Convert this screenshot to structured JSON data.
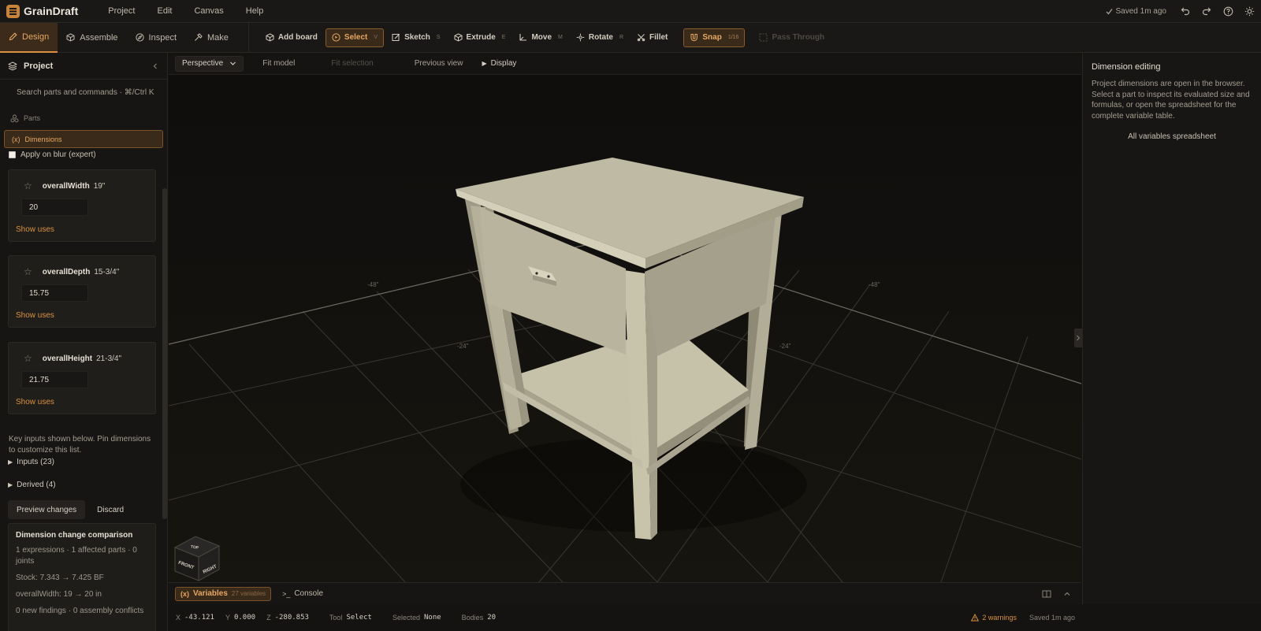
{
  "app": {
    "name": "GrainDraft",
    "menus": [
      "Project",
      "Edit",
      "Canvas",
      "Help"
    ],
    "saved_status": "Saved 1m ago"
  },
  "workspaces": [
    {
      "label": "Design",
      "icon": "pencil-icon",
      "active": true
    },
    {
      "label": "Assemble",
      "icon": "cube-icon",
      "active": false
    },
    {
      "label": "Inspect",
      "icon": "compass-icon",
      "active": false
    },
    {
      "label": "Make",
      "icon": "hammer-icon",
      "active": false
    }
  ],
  "tools": [
    {
      "label": "Add board",
      "key": "",
      "icon": "cube-plus-icon",
      "state": "normal"
    },
    {
      "label": "Select",
      "key": "V",
      "icon": "cursor-circle-icon",
      "state": "active"
    },
    {
      "label": "Sketch",
      "key": "S",
      "icon": "sketch-icon",
      "state": "normal"
    },
    {
      "label": "Extrude",
      "key": "E",
      "icon": "extrude-icon",
      "state": "normal"
    },
    {
      "label": "Move",
      "key": "M",
      "icon": "move-icon",
      "state": "normal"
    },
    {
      "label": "Rotate",
      "key": "R",
      "icon": "rotate-icon",
      "state": "normal"
    },
    {
      "label": "Fillet",
      "key": "",
      "icon": "fillet-icon",
      "state": "normal"
    }
  ],
  "snap": {
    "label": "Snap",
    "value": "1/16"
  },
  "pass_through": {
    "label": "Pass Through"
  },
  "left_panel": {
    "title": "Project",
    "search_placeholder": "Search parts and commands · ⌘/Ctrl K",
    "parts_label": "Parts",
    "dimensions_label": "Dimensions",
    "apply_on_blur": "Apply on blur (expert)",
    "dimensions": [
      {
        "name": "overallWidth",
        "display": "19\"",
        "input": "20",
        "uses": "Show uses"
      },
      {
        "name": "overallDepth",
        "display": "15-3/4\"",
        "input": "15.75",
        "uses": "Show uses"
      },
      {
        "name": "overallHeight",
        "display": "21-3/4\"",
        "input": "21.75",
        "uses": "Show uses"
      }
    ],
    "hint": "Key inputs shown below. Pin dimensions to customize this list.",
    "inputs_label": "Inputs (23)",
    "derived_label": "Derived (4)",
    "preview_button": "Preview changes",
    "discard_button": "Discard",
    "comparison": {
      "title": "Dimension change comparison",
      "summary": "1 expressions · 1 affected parts · 0 joints",
      "stock": "Stock: 7.343 → 7.425 BF",
      "change": "overallWidth: 19 → 20 in",
      "findings": "0 new findings · 0 assembly conflicts"
    }
  },
  "view_toolbar": {
    "projection": "Perspective",
    "fit_model": "Fit model",
    "fit_selection": "Fit selection",
    "previous_view": "Previous view",
    "display": "Display"
  },
  "viewport": {
    "grid_labels": [
      "-48\"",
      "-48\"",
      "-24\"",
      "-24\""
    ],
    "view_cube": {
      "top": "TOP",
      "front": "FRONT",
      "right": "RIGHT"
    }
  },
  "right_panel": {
    "title": "Dimension editing",
    "description": "Project dimensions are open in the browser. Select a part to inspect its evaluated size and formulas, or open the spreadsheet for the complete variable table.",
    "link": "All variables spreadsheet"
  },
  "bottom_tabs": {
    "variables": "Variables",
    "variables_count": "27 variables",
    "console": "Console"
  },
  "status": {
    "x_label": "X",
    "x": "-43.121",
    "y_label": "Y",
    "y": "0.000",
    "z_label": "Z",
    "z": "-280.853",
    "tool_label": "Tool",
    "tool": "Select",
    "selected_label": "Selected",
    "selected": "None",
    "bodies_label": "Bodies",
    "bodies": "20",
    "warnings": "2 warnings",
    "saved": "Saved 1m ago"
  },
  "colors": {
    "accent": "#d9913f",
    "accent_bg": "#3a2a1a",
    "wood": "#bdb8a0"
  }
}
